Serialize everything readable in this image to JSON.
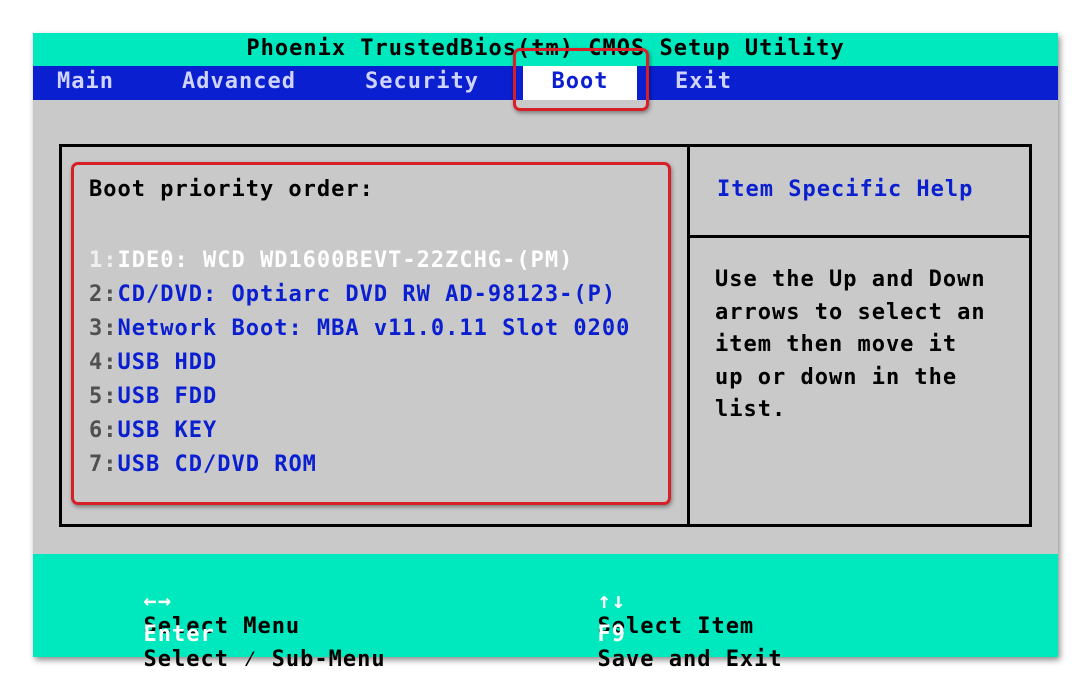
{
  "title": "Phoenix TrustedBios(tm) CMOS Setup Utility",
  "menu": {
    "items": [
      "Main",
      "Advanced",
      "Security",
      "Boot",
      "Exit"
    ],
    "active": "Boot"
  },
  "boot": {
    "heading": "Boot priority order:",
    "items": [
      {
        "num": "1:",
        "name": "IDE0: WCD WD1600BEVT-22ZCHG-(PM)",
        "selected": true
      },
      {
        "num": "2:",
        "name": "CD/DVD: Optiarc DVD RW AD-98123-(P)"
      },
      {
        "num": "3:",
        "name": "Network Boot: MBA v11.0.11 Slot 0200"
      },
      {
        "num": "4:",
        "name": "USB HDD"
      },
      {
        "num": "5:",
        "name": "USB FDD"
      },
      {
        "num": "6:",
        "name": "USB KEY"
      },
      {
        "num": "7:",
        "name": "USB CD/DVD ROM"
      }
    ]
  },
  "help": {
    "title": "Item Specific Help",
    "lines": [
      "Use the Up and Down",
      "arrows to select an",
      "item then move it",
      "up or down in the",
      "list."
    ]
  },
  "footer": {
    "select_menu_key": "←→",
    "select_menu_desc": "Select Menu",
    "enter_key": "Enter",
    "enter_desc": "Select ⁄ Sub-Menu",
    "select_item_key": "↑↓",
    "select_item_desc": "Select Item",
    "save_key": "F9",
    "save_desc": "Save and Exit"
  },
  "colors": {
    "teal": "#00e8bd",
    "blue": "#0a1fd0",
    "gray": "#c9c9c9",
    "highlight": "#d61f26"
  }
}
